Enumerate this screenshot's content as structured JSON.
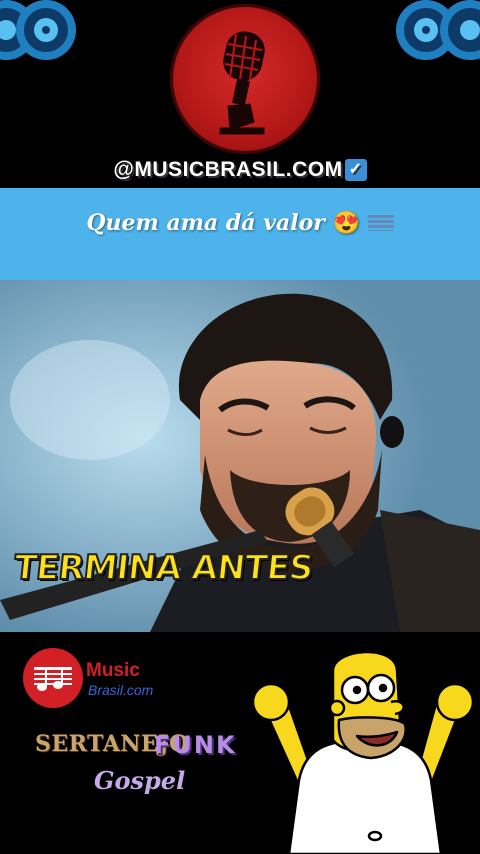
{
  "header": {
    "handle": "@MUSICBRASIL.COM",
    "verified_icon": "check-badge-icon"
  },
  "caption": {
    "text": "Quem ama dá valor",
    "emoji": "😍"
  },
  "video": {
    "overlay_text": "TERMINA ANTES"
  },
  "branding": {
    "logo_line1": "Music",
    "logo_line2": "Brasil.com"
  },
  "genres": [
    "SERTANEJO",
    "FUNK",
    "Gospel"
  ],
  "colors": {
    "caption_band": "#4db3ea",
    "overlay_text": "#ffe11a",
    "logo_red": "#d31f26"
  }
}
